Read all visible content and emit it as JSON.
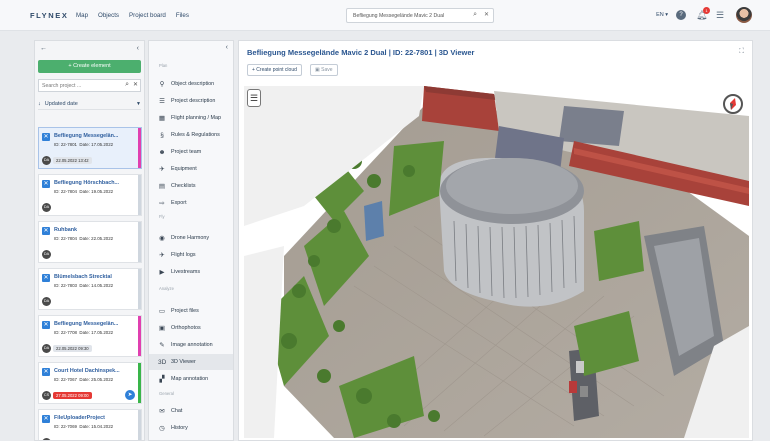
{
  "topbar": {
    "logo": "FLYNEX",
    "nav": [
      "Map",
      "Objects",
      "Project board",
      "Files"
    ],
    "search_value": "Befliegung Messegelände Mavic 2 Dual",
    "language": "EN ▾",
    "notification_count": "1"
  },
  "left_panel": {
    "create_label": "+ Create element",
    "search_placeholder": "Search project ...",
    "sort_label": "Updated date",
    "projects": [
      {
        "title": "Befliegung Messegelän...",
        "id": "22-7801",
        "date": "17.05.2022",
        "avatar": "DA",
        "stamp": "22.05.2022 13:42",
        "stamp_red": false,
        "stripe": "#e040b0",
        "selected": true
      },
      {
        "title": "Befliegung Hörschbach...",
        "id": "22-7804",
        "date": "19.05.2022",
        "avatar": "DA",
        "stamp": "",
        "stamp_red": false,
        "stripe": "#cfd6de",
        "selected": false
      },
      {
        "title": "Ruhbank",
        "id": "22-7804",
        "date": "22.05.2022",
        "avatar": "DA",
        "stamp": "",
        "stamp_red": false,
        "stripe": "#cfd6de",
        "selected": false
      },
      {
        "title": "Blümelsbach Strecktal",
        "id": "22-7803",
        "date": "14.05.2022",
        "avatar": "DA",
        "stamp": "",
        "stamp_red": false,
        "stripe": "#cfd6de",
        "selected": false
      },
      {
        "title": "Befliegung Messegelän...",
        "id": "22-7708",
        "date": "17.05.2022",
        "avatar": "DA",
        "stamp": "22.05.2022 09:30",
        "stamp_red": false,
        "stripe": "#e040b0",
        "selected": false
      },
      {
        "title": "Court Hotel Dachinspek...",
        "id": "22-7067",
        "date": "25.05.2022",
        "avatar": "CS",
        "stamp": "27.05.2022 09:00",
        "stamp_red": true,
        "stripe": "#39b54a",
        "selected": false
      },
      {
        "title": "FileUploaderProject",
        "id": "22-7069",
        "date": "15.04.2022",
        "avatar": "DA",
        "stamp": "",
        "stamp_red": false,
        "stripe": "#cfd6de",
        "selected": false
      }
    ]
  },
  "menu": {
    "sections": {
      "plan": "Plan",
      "fly": "Fly",
      "analyze": "Analyze",
      "general": "General"
    },
    "items": [
      {
        "name": "object-description",
        "label": "Object description",
        "icon": "⚲"
      },
      {
        "name": "project-description",
        "label": "Project description",
        "icon": "☰"
      },
      {
        "name": "flight-planning",
        "label": "Flight planning / Map",
        "icon": "▦"
      },
      {
        "name": "rules",
        "label": "Rules & Regulations",
        "icon": "§"
      },
      {
        "name": "project-team",
        "label": "Project team",
        "icon": "☻"
      },
      {
        "name": "equipment",
        "label": "Equipment",
        "icon": "✈"
      },
      {
        "name": "checklists",
        "label": "Checklists",
        "icon": "▤"
      },
      {
        "name": "export",
        "label": "Export",
        "icon": "⇨"
      },
      {
        "name": "drone-harmony",
        "label": "Drone Harmony",
        "icon": "◉"
      },
      {
        "name": "flight-logs",
        "label": "Flight logs",
        "icon": "✈"
      },
      {
        "name": "livestreams",
        "label": "Livestreams",
        "icon": "▶"
      },
      {
        "name": "project-files",
        "label": "Project files",
        "icon": "▭"
      },
      {
        "name": "orthophotos",
        "label": "Orthophotos",
        "icon": "▣"
      },
      {
        "name": "image-annotation",
        "label": "Image annotation",
        "icon": "✎"
      },
      {
        "name": "3d-viewer",
        "label": "3D Viewer",
        "icon": "3D"
      },
      {
        "name": "map-annotation",
        "label": "Map annotation",
        "icon": "▞"
      },
      {
        "name": "chat",
        "label": "Chat",
        "icon": "✉"
      },
      {
        "name": "history",
        "label": "History",
        "icon": "◷"
      }
    ]
  },
  "main": {
    "title": "Befliegung Messegelände Mavic 2 Dual | ID: 22-7801 | 3D Viewer",
    "create_point_cloud": "+ Create point cloud",
    "save": "Save"
  }
}
